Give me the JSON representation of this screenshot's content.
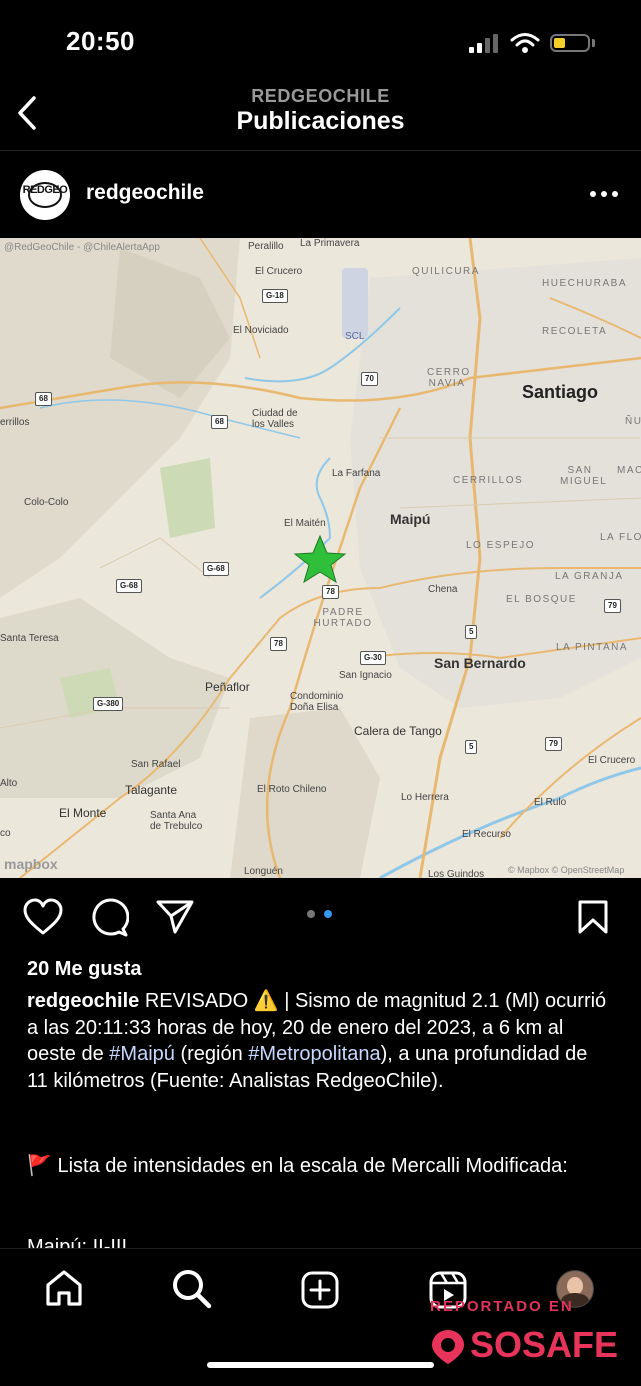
{
  "status_bar": {
    "time": "20:50"
  },
  "header": {
    "account": "REDGEOCHILE",
    "title": "Publicaciones"
  },
  "post": {
    "username": "redgeochile",
    "avatar_text": "REDGEO",
    "map": {
      "credit_top": "@RedGeoChile - @ChileAlertaApp",
      "credit_bottom": "© Mapbox © OpenStreetMap",
      "logo": "mapbox",
      "labels": {
        "peralillo": "Peralillo",
        "la_primavera": "La Primavera",
        "quilicura": "QUILICURA",
        "huechuraba": "HUECHURABA",
        "el_crucero_n": "El Crucero",
        "scl": "SCL",
        "recoleta": "RECOLETA",
        "el_noviciado": "El Noviciado",
        "cerro_navia": "CERRO NAVIA",
        "santiago": "Santiago",
        "errillos": "errillos",
        "ciudad_valles": "Ciudad de los Valles",
        "nu": "ÑU",
        "la_farfana": "La Farfana",
        "cerrillos": "CERRILLOS",
        "san_miguel": "SAN MIGUEL",
        "mac": "MAC",
        "colo_colo": "Colo-Colo",
        "el_maiten": "El Maitén",
        "maipu": "Maipú",
        "lo_espejo": "LO ESPEJO",
        "la_flo": "LA FLO",
        "la_granja": "LA GRANJA",
        "chena": "Chena",
        "el_bosque": "EL BOSQUE",
        "padre_hurtado": "PADRE HURTADO",
        "santa_teresa": "Santa Teresa",
        "la_pintana": "LA PINTANA",
        "san_bernardo": "San Bernardo",
        "san_ignacio": "San Ignacio",
        "penaflor": "Peñaflor",
        "condominio": "Condominio Doña Elisa",
        "calera_tango": "Calera de Tango",
        "el_crucero_s": "El Crucero",
        "san_rafael": "San Rafael",
        "alto": "Alto",
        "talagante": "Talagante",
        "el_roto_chileno": "El Roto Chileno",
        "lo_herrera": "Lo Herrera",
        "el_rulo": "El Rulo",
        "el_monte": "El Monte",
        "santa_ana": "Santa Ana de Trebulco",
        "co": "co",
        "el_recurso": "El Recurso",
        "longuen": "Longuén",
        "los_guindos": "Los Guindos"
      },
      "shields": {
        "g18": "G-18",
        "r70": "70",
        "r68a": "68",
        "r68b": "68",
        "g68a": "G-68",
        "g68b": "G-68",
        "r78a": "78",
        "r78b": "78",
        "r5a": "5",
        "r5b": "5",
        "g30": "G-30",
        "g380": "G-380",
        "r79a": "79",
        "r79b": "79"
      }
    },
    "carousel": {
      "total": 2,
      "active": 1
    },
    "likes": "20 Me gusta",
    "caption": {
      "part1": " REVISADO ⚠️ | Sismo de magnitud 2.1 (Ml) ocurrió a las 20:11:33 horas de hoy, 20 de enero del 2023, a 6 km al oeste de ",
      "tag1": "#Maipú",
      "part2": " (región ",
      "tag2": "#Metropolitana",
      "part3": "), a una profundidad de 11 kilómetros (Fuente: Analistas RedgeoChile)."
    },
    "caption_line2": "🚩 Lista de intensidades en la escala de Mercalli Modificada:",
    "caption_cut": "Maipú: II-III"
  },
  "watermark": {
    "top": "REPORTADO EN",
    "brand": "SOSAFE"
  }
}
